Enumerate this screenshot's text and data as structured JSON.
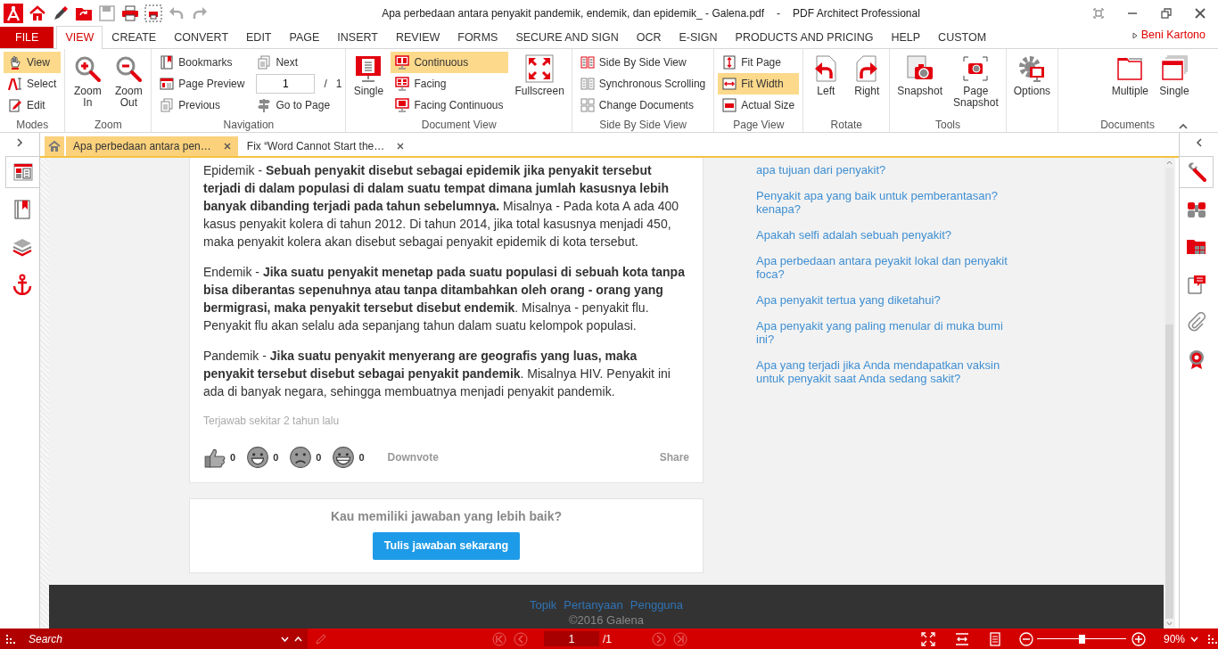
{
  "title_bar": {
    "document": "Apa perbedaan antara penyakit pandemik, endemik, dan epidemik_ - Galena.pdf",
    "separator": "-",
    "app": "PDF Architect Professional"
  },
  "menu_tabs": [
    {
      "label": "FILE",
      "kind": "file",
      "selected": false
    },
    {
      "label": "VIEW",
      "kind": "tab",
      "selected": true
    },
    {
      "label": "CREATE",
      "kind": "tab",
      "selected": false
    },
    {
      "label": "CONVERT",
      "kind": "tab",
      "selected": false
    },
    {
      "label": "EDIT",
      "kind": "tab",
      "selected": false
    },
    {
      "label": "PAGE",
      "kind": "tab",
      "selected": false
    },
    {
      "label": "INSERT",
      "kind": "tab",
      "selected": false
    },
    {
      "label": "REVIEW",
      "kind": "tab",
      "selected": false
    },
    {
      "label": "FORMS",
      "kind": "tab",
      "selected": false
    },
    {
      "label": "SECURE AND SIGN",
      "kind": "tab",
      "selected": false
    },
    {
      "label": "OCR",
      "kind": "tab",
      "selected": false
    },
    {
      "label": "E-SIGN",
      "kind": "tab",
      "selected": false
    },
    {
      "label": "PRODUCTS AND PRICING",
      "kind": "tab",
      "selected": false
    },
    {
      "label": "HELP",
      "kind": "tab",
      "selected": false
    },
    {
      "label": "CUSTOM",
      "kind": "tab",
      "selected": false
    }
  ],
  "user_name": "Beni Kartono",
  "ribbon": [
    {
      "label": "Modes",
      "columns": [
        [
          {
            "label": "View",
            "kind": "small",
            "selected": true
          },
          {
            "label": "Select",
            "kind": "small",
            "selected": false
          },
          {
            "label": "Edit",
            "kind": "small",
            "selected": false
          }
        ]
      ]
    },
    {
      "label": "Zoom",
      "columns": [
        [
          {
            "label": "Zoom In",
            "kind": "large"
          }
        ],
        [
          {
            "label": "Zoom Out",
            "kind": "large"
          }
        ]
      ]
    },
    {
      "label": "Navigation",
      "columns": [
        [
          {
            "label": "Bookmarks",
            "kind": "small"
          },
          {
            "label": "Page Preview",
            "kind": "small"
          },
          {
            "label": "Previous",
            "kind": "small"
          }
        ],
        [
          {
            "label": "Next",
            "kind": "small"
          },
          {
            "kind": "page_field",
            "value": "1",
            "separator": "/",
            "total": "1"
          },
          {
            "label": "Go to Page",
            "kind": "small"
          }
        ]
      ]
    },
    {
      "label": "Document View",
      "columns": [
        [
          {
            "label": "Single",
            "kind": "large",
            "selected": false
          }
        ],
        [
          {
            "label": "Continuous",
            "kind": "small",
            "selected": true
          },
          {
            "label": "Facing",
            "kind": "small",
            "selected": false
          },
          {
            "label": "Facing Continuous",
            "kind": "small",
            "selected": false
          }
        ],
        [
          {
            "label": "Fullscreen",
            "kind": "large"
          }
        ]
      ]
    },
    {
      "label": "Side By Side View",
      "columns": [
        [
          {
            "label": "Side By Side View",
            "kind": "small"
          },
          {
            "label": "Synchronous Scrolling",
            "kind": "small"
          },
          {
            "label": "Change Documents",
            "kind": "small"
          }
        ]
      ]
    },
    {
      "label": "Page View",
      "columns": [
        [
          {
            "label": "Fit Page",
            "kind": "small",
            "selected": false
          },
          {
            "label": "Fit Width",
            "kind": "small",
            "selected": true
          },
          {
            "label": "Actual Size",
            "kind": "small",
            "selected": false
          }
        ]
      ]
    },
    {
      "label": "Rotate",
      "columns": [
        [
          {
            "label": "Left",
            "kind": "large"
          }
        ],
        [
          {
            "label": "Right",
            "kind": "large"
          }
        ]
      ]
    },
    {
      "label": "Tools",
      "columns": [
        [
          {
            "label": "Snapshot",
            "kind": "large"
          }
        ],
        [
          {
            "label": "Page Snapshot",
            "kind": "large"
          }
        ]
      ]
    },
    {
      "columns": [
        [
          {
            "label": "Options",
            "kind": "large"
          }
        ]
      ]
    },
    {
      "label": "Documents",
      "columns": [
        [
          {
            "label": "Multiple",
            "kind": "large"
          }
        ],
        [
          {
            "label": "Single",
            "kind": "large"
          }
        ]
      ]
    }
  ],
  "left_panel": [
    {
      "selected": true
    },
    {
      "selected": false
    },
    {
      "selected": false
    },
    {
      "selected": false
    }
  ],
  "right_panel": [
    {
      "selected": true
    },
    {
      "selected": false
    },
    {
      "selected": false
    },
    {
      "selected": false
    },
    {
      "selected": false
    },
    {
      "selected": false
    }
  ],
  "document_tabs": [
    {
      "label": "Apa perbedaan antara pen…",
      "selected": true
    },
    {
      "label": "Fix “Word Cannot Start the…",
      "selected": false
    }
  ],
  "answer": {
    "paragraphs": [
      "Epidemik - **Sebuah penyakit disebut sebagai epidemik jika penyakit tersebut terjadi di dalam populasi di dalam suatu tempat dimana jumlah kasusnya lebih banyak dibanding terjadi pada tahun sebelumnya.** Misalnya - Pada kota A ada 400 kasus penyakit kolera di tahun 2012. Di tahun 2014, jika total kasusnya menjadi 450, maka penyakit kolera akan disebut sebagai penyakit epidemik di kota tersebut.",
      "Endemik - **Jika suatu penyakit menetap pada suatu populasi di sebuah kota tanpa bisa diberantas sepenuhnya atau tanpa ditambahkan oleh orang - orang yang bermigrasi, maka penyakit tersebut disebut endemik**. Misalnya - penyakit flu. Penyakit flu akan selalu ada sepanjang tahun dalam suatu kelompok populasi.",
      "Pandemik - **Jika suatu penyakit menyerang are geografis yang luas, maka penyakit tersebut disebut sebagai penyakit pandemik**. Misalnya HIV. Penyakit ini ada di banyak negara, sehingga membuatnya menjadi penyakit pandemik."
    ],
    "answered": "Terjawab sekitar 2 tahun lalu",
    "reactions": [
      {
        "count": "0"
      },
      {
        "count": "0"
      },
      {
        "count": "0"
      },
      {
        "count": "0"
      }
    ],
    "downvote": "Downvote",
    "share": "Share"
  },
  "better_answer": {
    "question": "Kau memiliki jawaban yang lebih baik?",
    "button": "Tulis jawaban sekarang"
  },
  "related_questions": [
    "apa tujuan dari penyakit?",
    "Penyakit apa yang baik untuk pemberantasan? kenapa?",
    "Apakah selfi adalah sebuah penyakit?",
    "Apa perbedaan antara peyakit lokal dan penyakit foca?",
    "Apa penyakit tertua yang diketahui?",
    "Apa penyakit yang paling menular di muka bumi ini?",
    "Apa yang terjadi jika Anda mendapatkan vaksin untuk penyakit saat Anda sedang sakit?"
  ],
  "footer": {
    "links": [
      "Topik",
      "Pertanyaan",
      "Pengguna"
    ],
    "copyright": "©2016 Galena"
  },
  "status_bar": {
    "search_placeholder": "Search",
    "page_value": "1",
    "page_total": "/1",
    "zoom_slider": {
      "level": 0.5
    },
    "zoom": "90%"
  }
}
